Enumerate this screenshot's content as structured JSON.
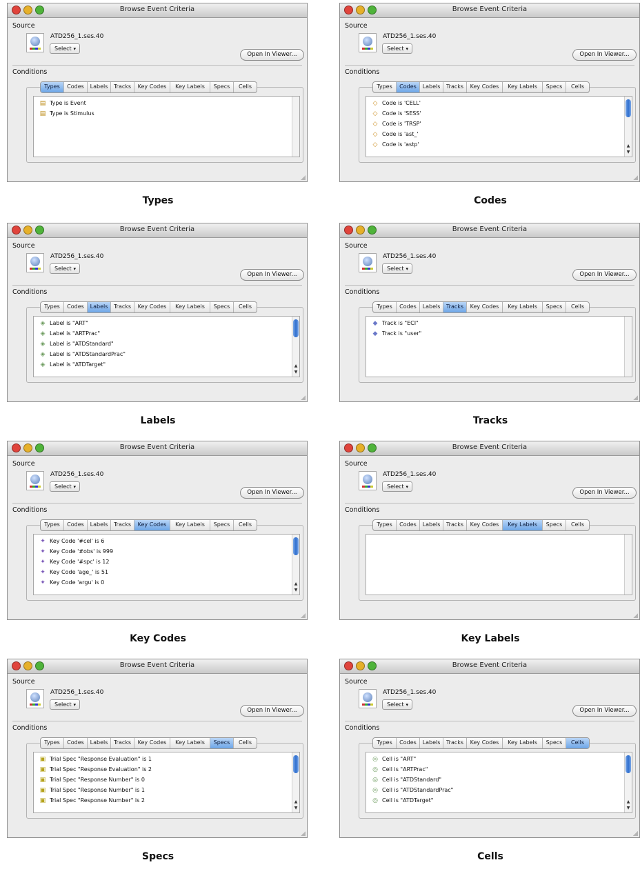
{
  "window_title": "Browse Event Criteria",
  "source_label": "Source",
  "file_name": "ATD256_1.ses.40",
  "select_label": "Select",
  "open_viewer_label": "Open In Viewer...",
  "conditions_label": "Conditions",
  "tabs": [
    "Types",
    "Codes",
    "Labels",
    "Tracks",
    "Key Codes",
    "Key Labels",
    "Specs",
    "Cells"
  ],
  "colors": {
    "close": "#e0443c",
    "minimize": "#e6b02a",
    "zoom": "#4fb33a",
    "active_tab": "#6ea6e8"
  },
  "panels": [
    {
      "caption": "Types",
      "active_tab": 0,
      "icon": "type-icon",
      "has_scroll_thumb": false,
      "items": [
        "Type is Event",
        "Type is Stimulus"
      ]
    },
    {
      "caption": "Codes",
      "active_tab": 1,
      "icon": "code-icon",
      "has_scroll_thumb": true,
      "items": [
        "Code is 'CELL'",
        "Code is 'SESS'",
        "Code is 'TRSP'",
        "Code is 'ast_'",
        "Code is 'astp'"
      ]
    },
    {
      "caption": "Labels",
      "active_tab": 2,
      "icon": "label-icon",
      "has_scroll_thumb": true,
      "items": [
        "Label is \"ART\"",
        "Label is \"ARTPrac\"",
        "Label is \"ATDStandard\"",
        "Label is \"ATDStandardPrac\"",
        "Label is \"ATDTarget\""
      ]
    },
    {
      "caption": "Tracks",
      "active_tab": 3,
      "icon": "track-icon",
      "has_scroll_thumb": false,
      "items": [
        "Track is \"ECI\"",
        "Track is \"user\""
      ]
    },
    {
      "caption": "Key Codes",
      "active_tab": 4,
      "icon": "key-code-icon",
      "has_scroll_thumb": true,
      "items": [
        "Key Code '#cel' is 6",
        "Key Code '#obs' is 999",
        "Key Code '#spc' is 12",
        "Key Code 'age_' is 51",
        "Key Code 'argu' is 0"
      ]
    },
    {
      "caption": "Key Labels",
      "active_tab": 5,
      "icon": "key-label-icon",
      "has_scroll_thumb": false,
      "items": []
    },
    {
      "caption": "Specs",
      "active_tab": 6,
      "icon": "spec-icon",
      "has_scroll_thumb": true,
      "items": [
        "Trial Spec \"Response Evaluation\" is 1",
        "Trial Spec \"Response Evaluation\" is 2",
        "Trial Spec \"Response Number\" is 0",
        "Trial Spec \"Response Number\" is 1",
        "Trial Spec \"Response Number\" is 2"
      ]
    },
    {
      "caption": "Cells",
      "active_tab": 7,
      "icon": "cell-icon",
      "has_scroll_thumb": true,
      "items": [
        "Cell is \"ART\"",
        "Cell is \"ARTPrac\"",
        "Cell is \"ATDStandard\"",
        "Cell is \"ATDStandardPrac\"",
        "Cell is \"ATDTarget\""
      ]
    }
  ]
}
